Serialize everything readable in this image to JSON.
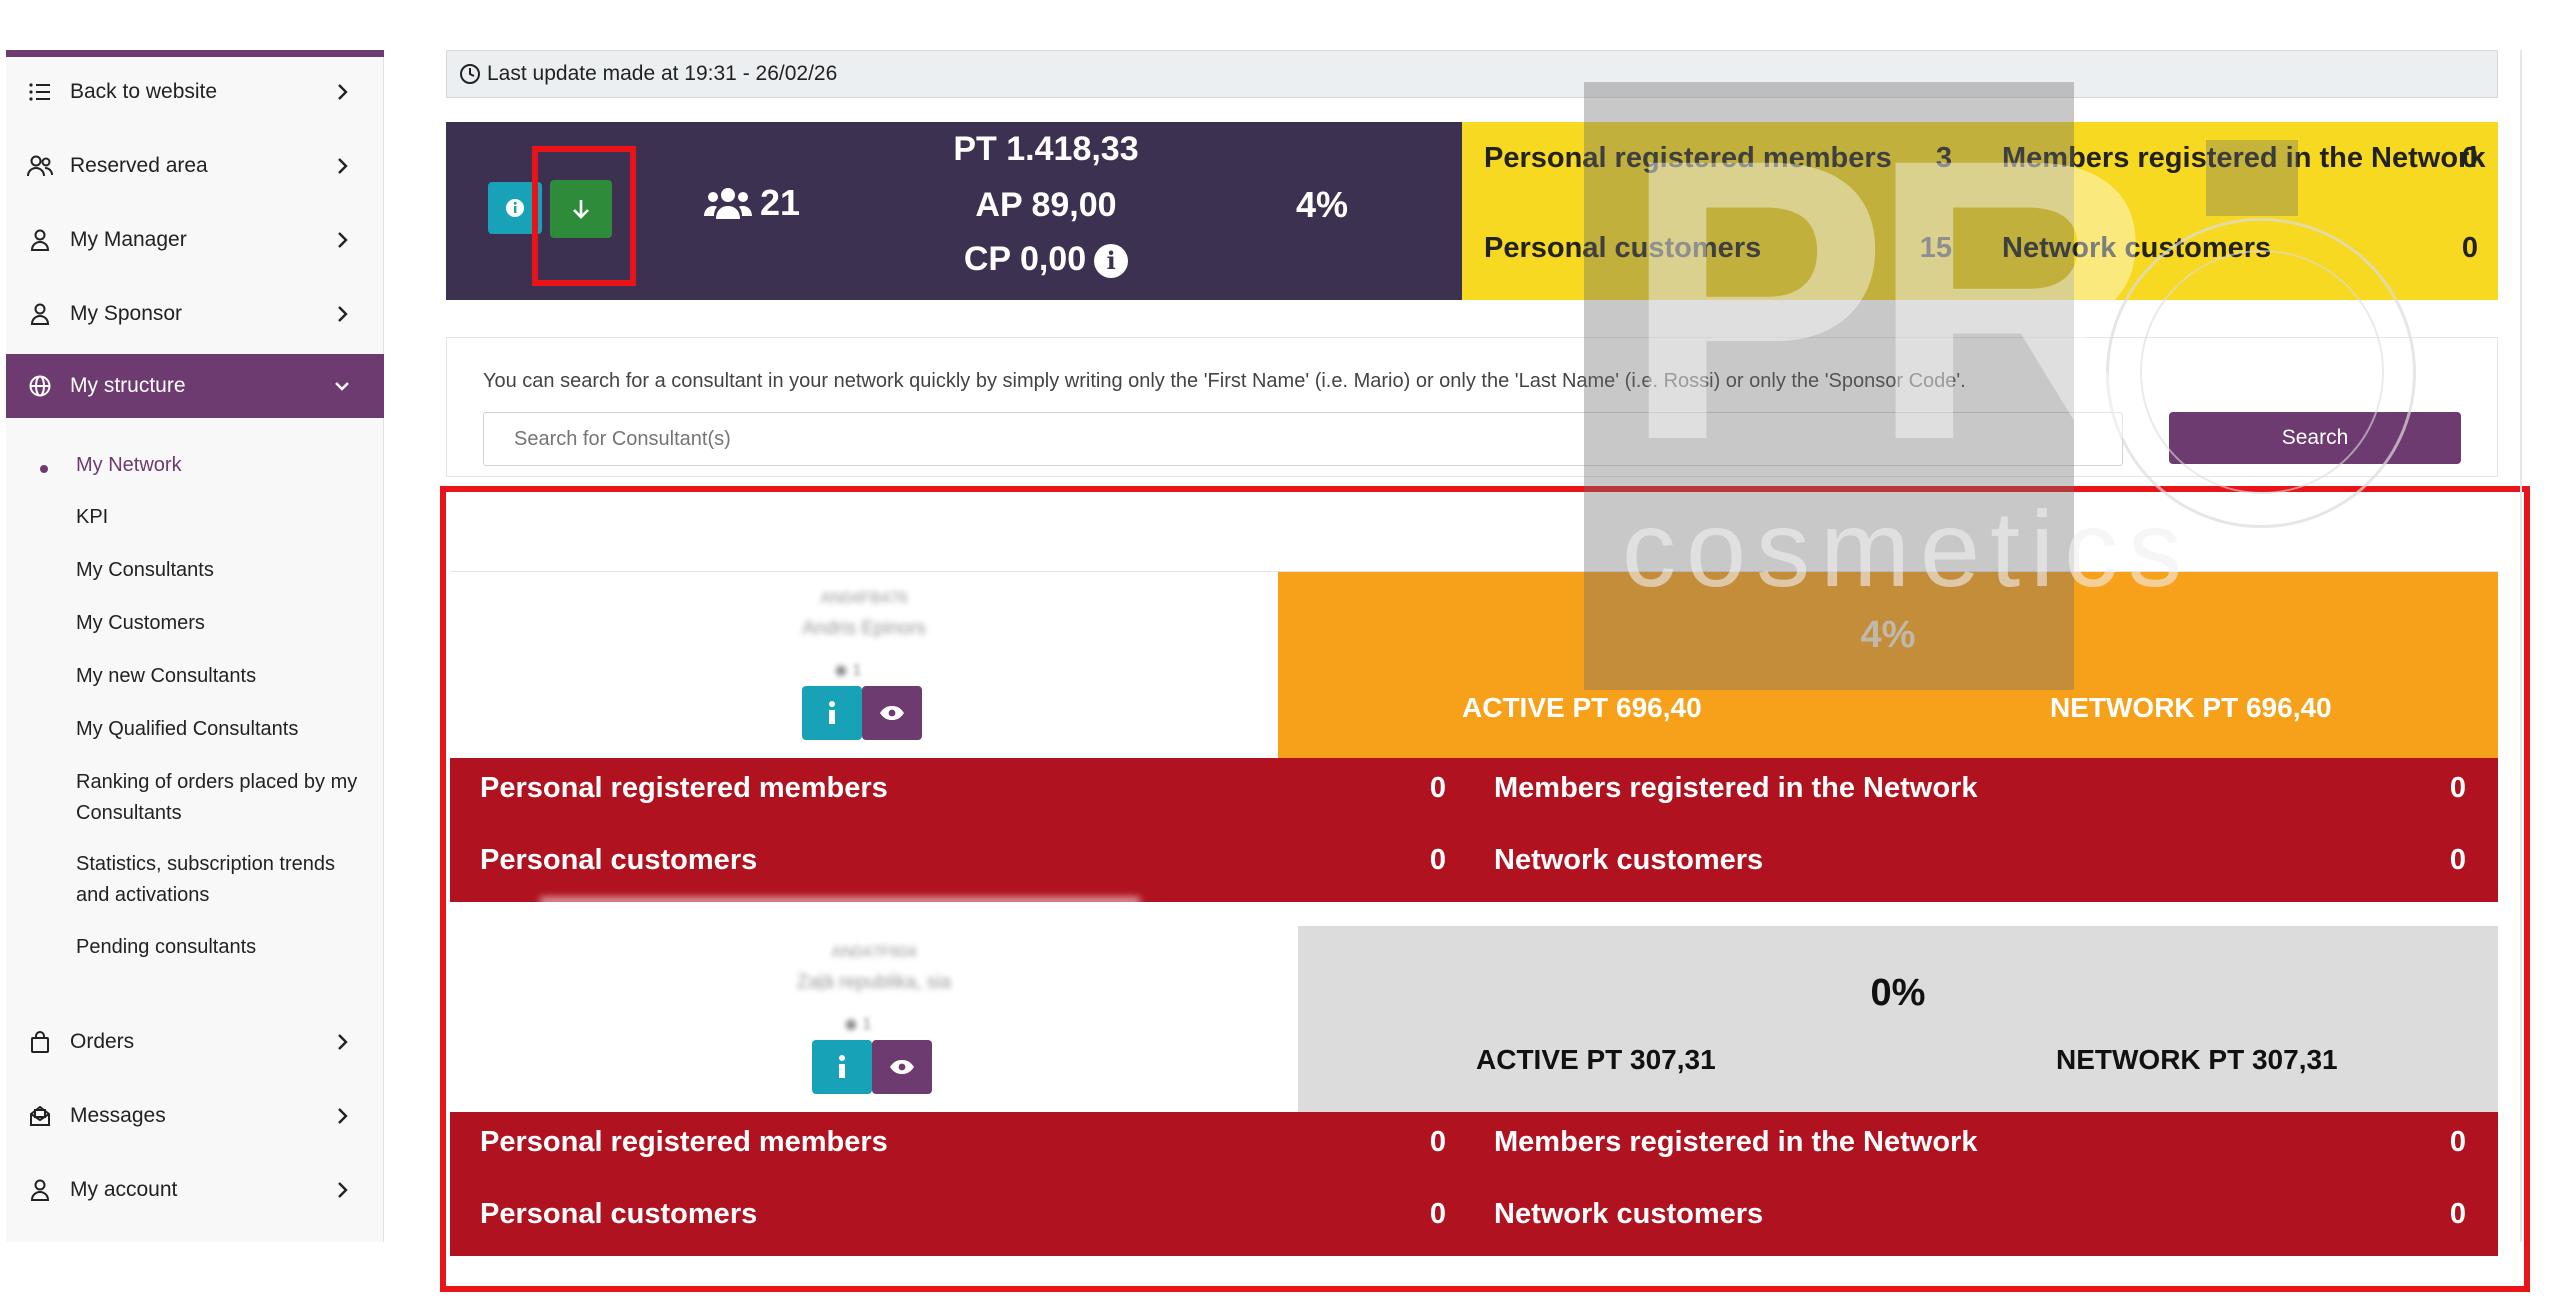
{
  "sidebar": {
    "items": [
      {
        "label": "Back to website",
        "icon": "list-icon"
      },
      {
        "label": "Reserved area",
        "icon": "users-icon"
      },
      {
        "label": "My Manager",
        "icon": "user-icon"
      },
      {
        "label": "My Sponsor",
        "icon": "user-icon"
      },
      {
        "label": "My structure",
        "icon": "globe-icon"
      }
    ],
    "submenu": [
      "My Network",
      "KPI",
      "My Consultants",
      "My Customers",
      "My new Consultants",
      "My Qualified Consultants",
      "Ranking of orders placed by my",
      "Consultants",
      "Statistics, subscription trends",
      "and activations",
      "Pending consultants"
    ],
    "bottom_items": [
      {
        "label": "Orders",
        "icon": "bag-icon"
      },
      {
        "label": "Messages",
        "icon": "envelope-icon"
      },
      {
        "label": "My account",
        "icon": "user-icon"
      }
    ]
  },
  "update": {
    "text": "Last update made at 19:31 - 26/02/26"
  },
  "summary": {
    "group_count": "21",
    "pt": "PT 1.418,33",
    "ap": "AP 89,00",
    "cp": "CP 0,00",
    "percent": "4%",
    "personal_registered_label": "Personal registered members",
    "personal_registered_value": "3",
    "network_registered_label": "Members registered in the Network",
    "network_registered_value": "0",
    "personal_customers_label": "Personal customers",
    "personal_customers_value": "15",
    "network_customers_label": "Network customers",
    "network_customers_value": "0"
  },
  "search": {
    "help": "You can search for a consultant in your network quickly by simply writing only the 'First Name' (i.e. Mario) or only the 'Last Name' (i.e. Rossi) or only the 'Sponsor Code'.",
    "placeholder": "Search for Consultant(s)",
    "button": "Search"
  },
  "consultants": [
    {
      "code": "AN04FB476",
      "name": "Andris Epinors",
      "count": "1",
      "percent": "4%",
      "active_pt": "ACTIVE PT 696,40",
      "network_pt": "NETWORK PT 696,40",
      "personal_registered_label": "Personal registered members",
      "personal_registered_value": "0",
      "network_registered_label": "Members registered in the Network",
      "network_registered_value": "0",
      "personal_customers_label": "Personal customers",
      "personal_customers_value": "0",
      "network_customers_label": "Network customers",
      "network_customers_value": "0"
    },
    {
      "code": "AN047F604",
      "name": "Zaļā republika, sia",
      "count": "1",
      "percent": "0%",
      "active_pt": "ACTIVE PT 307,31",
      "network_pt": "NETWORK PT 307,31",
      "personal_registered_label": "Personal registered members",
      "personal_registered_value": "0",
      "network_registered_label": "Members registered in the Network",
      "network_registered_value": "0",
      "personal_customers_label": "Personal customers",
      "personal_customers_value": "0",
      "network_customers_label": "Network customers",
      "network_customers_value": "0"
    }
  ],
  "watermark": {
    "brand": "PR",
    "tagline": "cosmetics"
  },
  "colors": {
    "purple": "#6e3b70",
    "dark": "#3d3151",
    "yellow": "#f6d920",
    "orange": "#f7a11a",
    "red": "#b01220",
    "teal": "#17a2b8",
    "green": "#2e8b3a",
    "highlight": "#e8141a"
  }
}
